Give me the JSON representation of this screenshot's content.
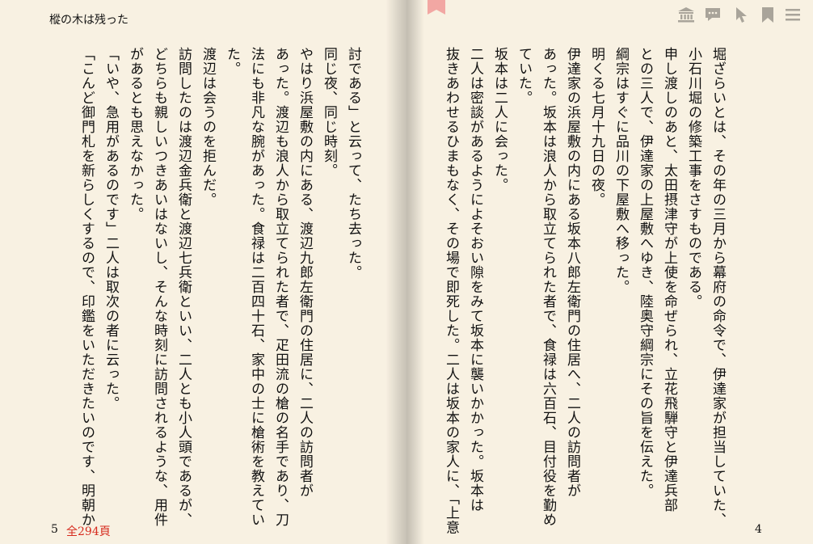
{
  "book": {
    "title": "樅の木は残った"
  },
  "pages": {
    "left": {
      "number": "5",
      "total": "全294頁",
      "columns": [
        "討である」と云って、たち去った。",
        "",
        "同じ夜、同じ時刻。",
        "やはり浜屋敷の内にある、渡辺九郎左衛門の住居に、二人の訪問者が",
        "あった。渡辺も浪人から取立てられた者で、疋田流の槍の名手であり、刀",
        "法にも非凡な腕があった。食禄は二百四十石、家中の士に槍術を教えてい",
        "た。",
        "渡辺は会うのを拒んだ。",
        "訪問したのは渡辺金兵衛と渡辺七兵衛といい、二人とも小人頭であるが、",
        "どちらも親しいつきあいはないし、そんな時刻に訪問されるような、用件",
        "があるとも思えなかった。",
        "「いや、急用があるのです」二人は取次の者に云った。",
        "「こんど御門札を新らしくするので、印鑑をいただきたいのです、明朝か"
      ]
    },
    "right": {
      "number": "4",
      "columns": [
        "堀ざらいとは、その年の三月から幕府の命令で、伊達家が担当していた、",
        "小石川堀の修築工事をさすものである。",
        "申し渡しのあと、太田摂津守が上使を命ぜられ、立花飛騨守と伊達兵部",
        "との三人で、伊達家の上屋敷へゆき、陸奥守綱宗にその旨を伝えた。",
        "綱宗はすぐに品川の下屋敷へ移った。",
        "",
        "明くる七月十九日の夜。",
        "伊達家の浜屋敷の内にある坂本八郎左衛門の住居へ、二人の訪問者が",
        "あった。坂本は浪人から取立てられた者で、食禄は六百石、目付役を勤め",
        "ていた。",
        "坂本は二人に会った。",
        "二人は密談があるようによそおい隙をみて坂本に襲いかかった。坂本は",
        "抜きあわせるひまもなく、その場で即死した。二人は坂本の家人に、「上意"
      ]
    }
  },
  "toolbar": {
    "icons": [
      "library-icon",
      "comment-icon",
      "pointer-icon",
      "bookmark-icon",
      "menu-icon"
    ]
  },
  "colors": {
    "page": "#f8f1e2",
    "accent_red": "#d62b1e",
    "ribbon": "#f2a7a3",
    "icon_gray": "#a9a49a"
  }
}
